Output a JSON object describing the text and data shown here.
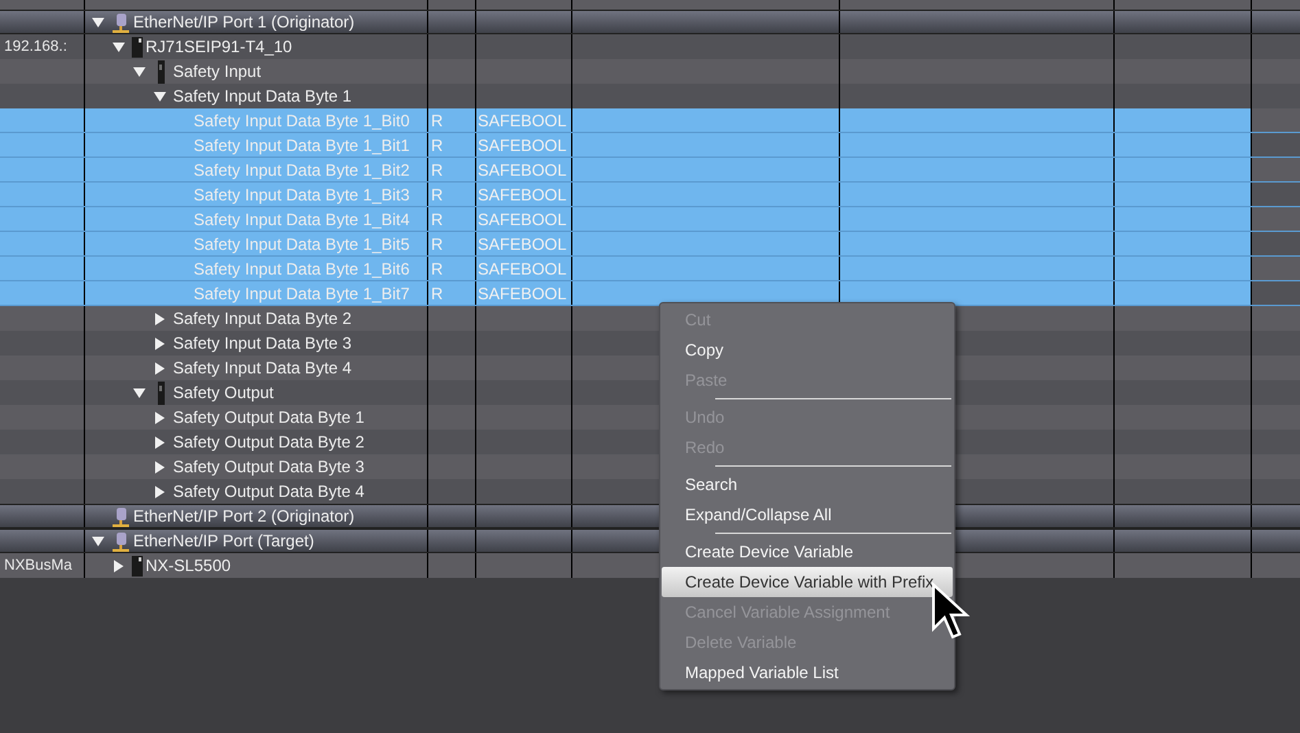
{
  "tree": [
    {
      "kind": "port",
      "label": "EtherNet/IP Port 1 (Originator)",
      "expanded": true,
      "children": [
        {
          "kind": "device",
          "label": "RJ71SEIP91-T4_10",
          "column_1": "192.168.:",
          "expanded": true,
          "children": [
            {
              "kind": "module",
              "label": "Safety Input",
              "expanded": true,
              "children": [
                {
                  "label": "Safety Input Data Byte 1",
                  "expanded": true,
                  "children": [
                    {
                      "label": "Safety Input Data Byte 1_Bit0",
                      "access": "R",
                      "type": "SAFEBOOL",
                      "selected": true
                    },
                    {
                      "label": "Safety Input Data Byte 1_Bit1",
                      "access": "R",
                      "type": "SAFEBOOL",
                      "selected": true
                    },
                    {
                      "label": "Safety Input Data Byte 1_Bit2",
                      "access": "R",
                      "type": "SAFEBOOL",
                      "selected": true
                    },
                    {
                      "label": "Safety Input Data Byte 1_Bit3",
                      "access": "R",
                      "type": "SAFEBOOL",
                      "selected": true
                    },
                    {
                      "label": "Safety Input Data Byte 1_Bit4",
                      "access": "R",
                      "type": "SAFEBOOL",
                      "selected": true
                    },
                    {
                      "label": "Safety Input Data Byte 1_Bit5",
                      "access": "R",
                      "type": "SAFEBOOL",
                      "selected": true
                    },
                    {
                      "label": "Safety Input Data Byte 1_Bit6",
                      "access": "R",
                      "type": "SAFEBOOL",
                      "selected": true
                    },
                    {
                      "label": "Safety Input Data Byte 1_Bit7",
                      "access": "R",
                      "type": "SAFEBOOL",
                      "selected": true
                    }
                  ]
                },
                {
                  "label": "Safety Input Data Byte 2",
                  "expanded": false
                },
                {
                  "label": "Safety Input Data Byte 3",
                  "expanded": false
                },
                {
                  "label": "Safety Input Data Byte 4",
                  "expanded": false
                }
              ]
            },
            {
              "kind": "module",
              "label": "Safety Output",
              "expanded": true,
              "children": [
                {
                  "label": "Safety Output Data Byte 1",
                  "expanded": false
                },
                {
                  "label": "Safety Output Data Byte 2",
                  "expanded": false
                },
                {
                  "label": "Safety Output Data Byte 3",
                  "expanded": false
                },
                {
                  "label": "Safety Output Data Byte 4",
                  "expanded": false
                }
              ]
            }
          ]
        }
      ]
    },
    {
      "kind": "port",
      "label": "EtherNet/IP Port 2 (Originator)"
    },
    {
      "kind": "port",
      "label": "EtherNet/IP Port (Target)",
      "expanded": true,
      "children": [
        {
          "kind": "device",
          "label": "NX-SL5500",
          "column_1": "NXBusMa",
          "expanded": false
        }
      ]
    }
  ],
  "context_menu": [
    {
      "label": "Cut",
      "disabled": true,
      "selected": false
    },
    {
      "label": "Copy",
      "disabled": false,
      "selected": false
    },
    {
      "label": "Paste",
      "disabled": true,
      "selected": false,
      "separator_after": true
    },
    {
      "label": "Undo",
      "disabled": true,
      "selected": false
    },
    {
      "label": "Redo",
      "disabled": true,
      "selected": false,
      "separator_after": true
    },
    {
      "label": "Search",
      "disabled": false,
      "selected": false
    },
    {
      "label": "Expand/Collapse All",
      "disabled": false,
      "selected": false,
      "separator_after": true
    },
    {
      "label": "Create Device Variable",
      "disabled": false,
      "selected": false
    },
    {
      "label": "Create Device Variable with Prefix",
      "disabled": false,
      "selected": true
    },
    {
      "label": "Cancel Variable Assignment",
      "disabled": true,
      "selected": false
    },
    {
      "label": "Delete Variable",
      "disabled": true,
      "selected": false
    },
    {
      "label": "Mapped Variable List",
      "disabled": false,
      "selected": false
    }
  ]
}
